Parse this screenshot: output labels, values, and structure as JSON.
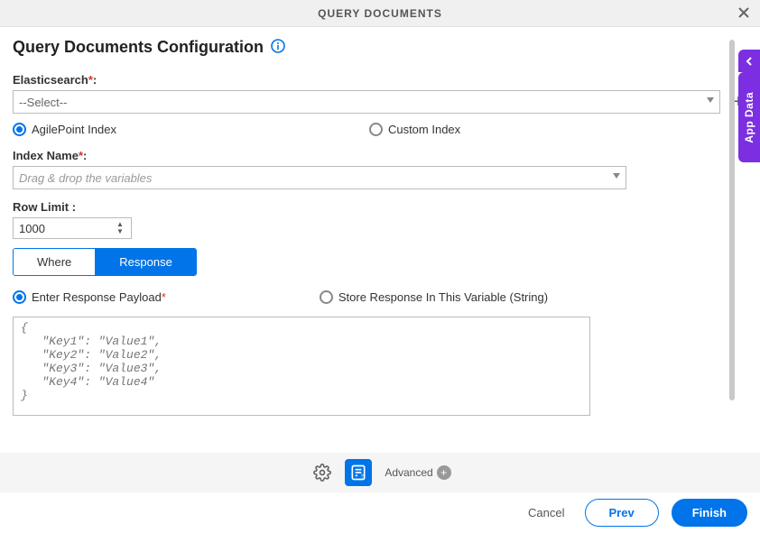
{
  "header": {
    "title": "QUERY DOCUMENTS"
  },
  "page_title": "Query Documents Configuration",
  "elasticsearch": {
    "label": "Elasticsearch",
    "select_placeholder": "--Select--"
  },
  "index_type": {
    "options": [
      "AgilePoint Index",
      "Custom Index"
    ],
    "selected": 0
  },
  "index_name": {
    "label": "Index Name",
    "placeholder": "Drag & drop the variables"
  },
  "row_limit": {
    "label": "Row Limit :",
    "value": "1000"
  },
  "tabs": {
    "items": [
      "Where",
      "Response"
    ],
    "active": 1
  },
  "response_mode": {
    "options": [
      "Enter Response Payload",
      "Store Response In This Variable (String)"
    ],
    "selected": 0
  },
  "payload_placeholder": "{\n   \"Key1\": \"Value1\",\n   \"Key2\": \"Value2\",\n   \"Key3\": \"Value3\",\n   \"Key4\": \"Value4\"\n}",
  "footer": {
    "advanced": "Advanced",
    "cancel": "Cancel",
    "prev": "Prev",
    "finish": "Finish"
  },
  "side_tab": "App Data"
}
